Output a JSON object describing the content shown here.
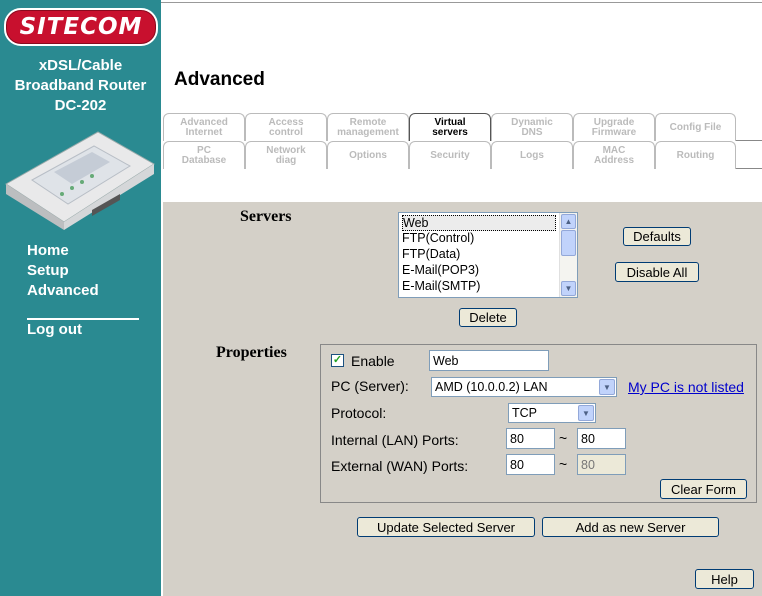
{
  "sidebar": {
    "logo_text": "SITECOM",
    "product_line1": "xDSL/Cable",
    "product_line2": "Broadband Router",
    "product_line3": "DC-202",
    "nav": [
      "Home",
      "Setup",
      "Advanced",
      "Log out"
    ]
  },
  "page_title": "Advanced",
  "tabs_row1": [
    {
      "line1": "Advanced",
      "line2": "Internet"
    },
    {
      "line1": "Access",
      "line2": "control"
    },
    {
      "line1": "Remote",
      "line2": "management"
    },
    {
      "line1": "Virtual",
      "line2": "servers"
    },
    {
      "line1": "Dynamic",
      "line2": "DNS"
    },
    {
      "line1": "Upgrade",
      "line2": "Firmware"
    },
    {
      "line1": "Config File",
      "line2": ""
    }
  ],
  "tabs_row2": [
    {
      "line1": "PC",
      "line2": "Database"
    },
    {
      "line1": "Network",
      "line2": "diag"
    },
    {
      "line1": "Options",
      "line2": ""
    },
    {
      "line1": "Security",
      "line2": ""
    },
    {
      "line1": "Logs",
      "line2": ""
    },
    {
      "line1": "MAC",
      "line2": "Address"
    },
    {
      "line1": "Routing",
      "line2": ""
    }
  ],
  "servers": {
    "heading": "Servers",
    "list": [
      "Web",
      "FTP(Control)",
      "FTP(Data)",
      "E-Mail(POP3)",
      "E-Mail(SMTP)"
    ],
    "selected": "Web",
    "defaults_btn": "Defaults",
    "disable_all_btn": "Disable All",
    "delete_btn": "Delete"
  },
  "properties": {
    "heading": "Properties",
    "enable_label": "Enable",
    "enabled": true,
    "name_value": "Web",
    "pc_label": "PC (Server):",
    "pc_value": "AMD (10.0.0.2) LAN",
    "pc_link": "My PC is not listed",
    "protocol_label": "Protocol:",
    "protocol_value": "TCP",
    "lan_label": "Internal (LAN) Ports:",
    "lan_from": "80",
    "lan_to": "80",
    "wan_label": "External (WAN) Ports:",
    "wan_from": "80",
    "wan_to": "80",
    "range_sep": "~",
    "clear_btn": "Clear Form"
  },
  "actions": {
    "update_btn": "Update Selected Server",
    "add_btn": "Add as new Server",
    "help_btn": "Help"
  },
  "colors": {
    "sidebar": "#2a8a91",
    "logo": "#c8102e",
    "content_bg": "#d4d0c8",
    "link": "#0000cc"
  },
  "icons": {
    "checkbox": "check-mark-icon",
    "scroll_up": "triangle-up-icon",
    "scroll_down": "triangle-down-icon",
    "dropdown": "triangle-down-icon"
  }
}
